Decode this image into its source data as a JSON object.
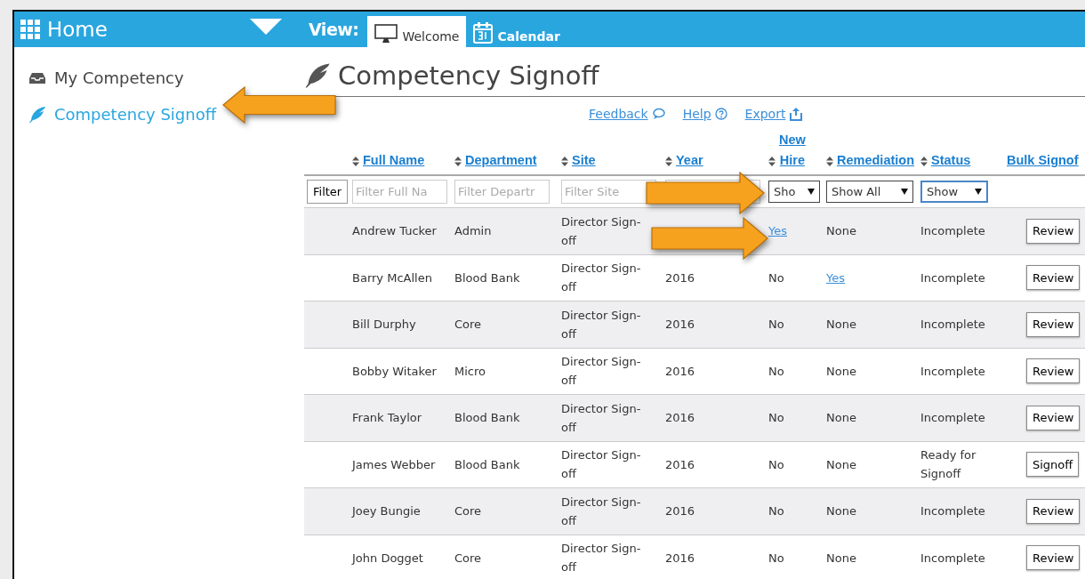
{
  "header": {
    "title": "Home",
    "view_label": "View:",
    "tabs": [
      {
        "label": "Welcome",
        "selected": true
      },
      {
        "label": "Calendar",
        "selected": false
      }
    ]
  },
  "sidebar": {
    "items": [
      {
        "label": "My Competency",
        "selected": false
      },
      {
        "label": "Competency Signoff",
        "selected": true
      }
    ]
  },
  "page": {
    "title": "Competency Signoff",
    "links": [
      {
        "label": "Feedback"
      },
      {
        "label": "Help"
      },
      {
        "label": "Export"
      }
    ]
  },
  "table": {
    "columns": [
      {
        "label": "Full Name",
        "sortable": true
      },
      {
        "label": "Department",
        "sortable": true
      },
      {
        "label": "Site",
        "sortable": true
      },
      {
        "label": "Year",
        "sortable": true
      },
      {
        "label": "New\nHire",
        "sortable": true
      },
      {
        "label": "Remediation",
        "sortable": true
      },
      {
        "label": "Status",
        "sortable": true
      },
      {
        "label": "Bulk Signof",
        "sortable": false
      }
    ],
    "filter_button": "Filter",
    "filters": [
      {
        "kind": "input",
        "placeholder": "Filter Full Na"
      },
      {
        "kind": "input",
        "placeholder": "Filter Departr"
      },
      {
        "kind": "input",
        "placeholder": "Filter Site"
      },
      {
        "kind": "input"
      },
      {
        "kind": "select",
        "value": "Sho"
      },
      {
        "kind": "select",
        "value": "Show All"
      },
      {
        "kind": "select",
        "value": "Show",
        "focused": true
      }
    ],
    "rows": [
      {
        "name": "Andrew Tucker",
        "department": "Admin",
        "site": "Director Sign-off",
        "new_hire": {
          "text": "Yes",
          "link": true
        },
        "remediation": {
          "text": "None",
          "link": false
        },
        "status": "Incomplete",
        "action": "Review"
      },
      {
        "name": "Barry McAllen",
        "department": "Blood Bank",
        "site": "Director Sign-off",
        "year": "2016",
        "new_hire": {
          "text": "No",
          "link": false
        },
        "remediation": {
          "text": "Yes",
          "link": true
        },
        "status": "Incomplete",
        "action": "Review"
      },
      {
        "name": "Bill Durphy",
        "department": "Core",
        "site": "Director Sign-off",
        "year": "2016",
        "new_hire": {
          "text": "No",
          "link": false
        },
        "remediation": {
          "text": "None",
          "link": false
        },
        "status": "Incomplete",
        "action": "Review"
      },
      {
        "name": "Bobby Witaker",
        "department": "Micro",
        "site": "Director Sign-off",
        "year": "2016",
        "new_hire": {
          "text": "No",
          "link": false
        },
        "remediation": {
          "text": "None",
          "link": false
        },
        "status": "Incomplete",
        "action": "Review"
      },
      {
        "name": "Frank Taylor",
        "department": "Blood Bank",
        "site": "Director Sign-off",
        "year": "2016",
        "new_hire": {
          "text": "No",
          "link": false
        },
        "remediation": {
          "text": "None",
          "link": false
        },
        "status": "Incomplete",
        "action": "Review"
      },
      {
        "name": "James Webber",
        "department": "Blood Bank",
        "site": "Director Sign-off",
        "year": "2016",
        "new_hire": {
          "text": "No",
          "link": false
        },
        "remediation": {
          "text": "None",
          "link": false
        },
        "status": "Ready for Signoff",
        "action": "Signoff"
      },
      {
        "name": "Joey Bungie",
        "department": "Core",
        "site": "Director Sign-off",
        "year": "2016",
        "new_hire": {
          "text": "No",
          "link": false
        },
        "remediation": {
          "text": "None",
          "link": false
        },
        "status": "Incomplete",
        "action": "Review"
      },
      {
        "name": "John Dogget",
        "department": "Core",
        "site": "Director Sign-off",
        "year": "2016",
        "new_hire": {
          "text": "No",
          "link": false
        },
        "remediation": {
          "text": "None",
          "link": false
        },
        "status": "Incomplete",
        "action": "Review"
      }
    ]
  },
  "callout_arrows": [
    {
      "kind": "left"
    },
    {
      "kind": "right"
    },
    {
      "kind": "right"
    }
  ]
}
